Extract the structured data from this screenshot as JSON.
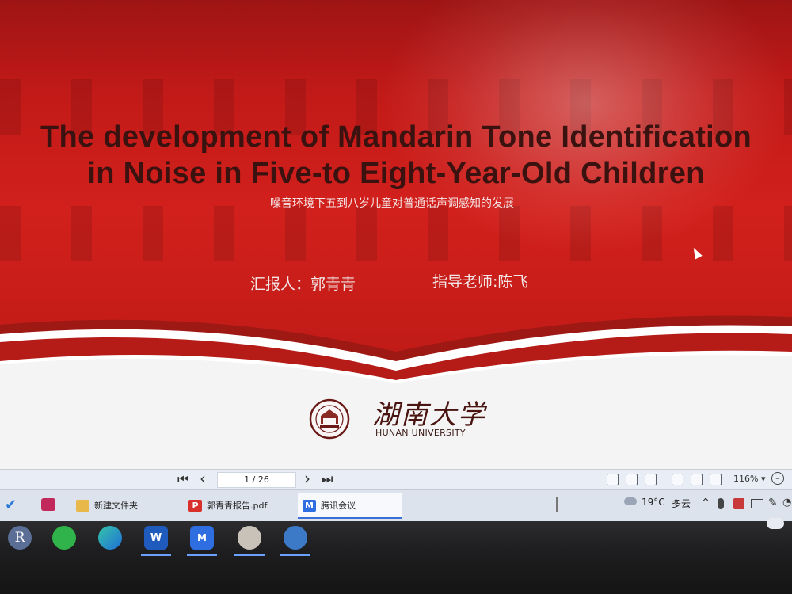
{
  "slide": {
    "title_line1": "The development of Mandarin Tone Identification",
    "title_line2": "in Noise in Five-to Eight-Year-Old Children",
    "subtitle": "噪音环境下五到八岁儿童对普通话声调感知的发展",
    "reporter": "汇报人：郭青青",
    "advisor": "指导老师:陈飞",
    "university_cn": "湖南大学",
    "university_en": "HUNAN UNIVERSITY"
  },
  "pdf_viewer": {
    "page_indicator": "1 / 26",
    "first_page_icon": "⏮",
    "prev_page_icon": "‹",
    "next_page_icon": "›",
    "last_page_icon": "⏭",
    "zoom_level": "116%",
    "zoom_dropdown_icon": "▾"
  },
  "window_bar": {
    "tabs": [
      {
        "label": "新建文件夹",
        "icon": "folder-icon"
      },
      {
        "label": "郭青青报告.pdf",
        "icon": "pdf-icon"
      },
      {
        "label": "腾讯会议",
        "icon": "tencent-meeting-icon"
      }
    ],
    "weather_temp": "19°C",
    "weather_desc": "多云",
    "chevron": "^"
  },
  "dock": {
    "avatar_letter": "R",
    "apps": [
      "wechat",
      "edge",
      "word",
      "tencent-meeting",
      "photos",
      "paint"
    ]
  },
  "colors": {
    "slide_red": "#c41c18",
    "title_dark": "#3a1210",
    "accent_blue": "#3a6fd8"
  }
}
